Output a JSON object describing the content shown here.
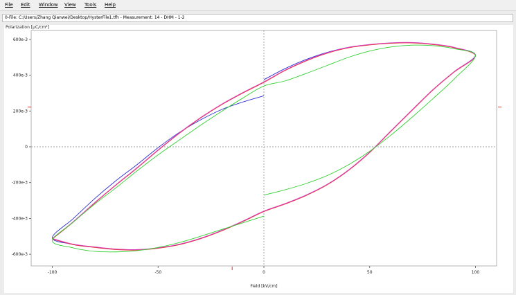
{
  "menu": {
    "file": "File",
    "edit": "Edit",
    "window": "Window",
    "view": "View",
    "tools": "Tools",
    "help": "Help"
  },
  "title_bar": {
    "text": "0-File: C:/Users/Zhang Qianwei/Desktop/HysterFile1.tfh - Measurement: 14 - DHM - 1-2"
  },
  "colors": {
    "blue": "#2b2bd4",
    "red": "#e53030",
    "green": "#2fcf2f",
    "pink": "#e040c0",
    "dashed_axis": "#808080",
    "marker": "#e03030"
  },
  "chart_data": {
    "type": "line",
    "xlabel": "Field [kV/cm]",
    "ylabel": "Polarization [µC/cm²]",
    "xlim": [
      -110,
      110
    ],
    "ylim": [
      -660,
      660
    ],
    "xticks": [
      -100,
      -50,
      0,
      50,
      100
    ],
    "xtick_labels": [
      "-100",
      "-50",
      "0",
      "50",
      "100"
    ],
    "yticks": [
      600,
      400,
      200,
      0,
      -200,
      -400,
      -600
    ],
    "ytick_labels": [
      "600e-3",
      "400e-3",
      "200e-3",
      "0",
      "-200e-3",
      "-400e-3",
      "-600e-3"
    ],
    "grid": false,
    "zero_lines_dashed": true,
    "series": [
      {
        "color_key": "blue",
        "x": [
          0,
          10,
          20,
          30,
          40,
          50,
          60,
          70,
          80,
          90,
          100,
          90,
          80,
          70,
          60,
          50,
          40,
          30,
          20,
          10,
          0,
          -10,
          -20,
          -30,
          -40,
          -50,
          -60,
          -70,
          -80,
          -90,
          -100,
          -90,
          -80,
          -70,
          -60,
          -50,
          -40,
          -30,
          -20,
          -10,
          0
        ],
        "y": [
          375,
          437,
          488,
          528,
          556,
          571,
          580,
          582,
          573,
          555,
          512,
          420,
          320,
          205,
          88,
          -30,
          -130,
          -210,
          -270,
          -318,
          -360,
          -416,
          -468,
          -512,
          -545,
          -565,
          -575,
          -572,
          -560,
          -545,
          -508,
          -400,
          -290,
          -190,
          -100,
          -5,
          80,
          150,
          208,
          250,
          285
        ]
      },
      {
        "color_key": "red",
        "x": [
          -100,
          -90,
          -80,
          -70,
          -60,
          -50,
          -40,
          -30,
          -20,
          -10,
          0,
          10,
          20,
          30,
          40,
          50,
          60,
          70,
          80,
          90,
          100,
          90,
          80,
          70,
          60,
          50,
          40,
          30,
          20,
          10,
          0,
          -10,
          -20,
          -30,
          -40,
          -50,
          -60,
          -70,
          -80,
          -90,
          -100
        ],
        "y": [
          -515,
          -420,
          -315,
          -215,
          -120,
          -20,
          75,
          160,
          235,
          300,
          360,
          426,
          480,
          523,
          553,
          569,
          578,
          580,
          571,
          553,
          508,
          418,
          318,
          203,
          86,
          -32,
          -132,
          -212,
          -272,
          -320,
          -362,
          -418,
          -470,
          -514,
          -547,
          -567,
          -577,
          -574,
          -562,
          -547,
          -515
        ]
      },
      {
        "color_key": "pink",
        "x": [
          -100,
          -90,
          -80,
          -70,
          -60,
          -50,
          -40,
          -30,
          -20,
          -10,
          0,
          10,
          20,
          30,
          40,
          50,
          60,
          70,
          80,
          90,
          100,
          90,
          80,
          70,
          60,
          50,
          40,
          30,
          20,
          10,
          0,
          -10,
          -20,
          -30,
          -40,
          -50,
          -60,
          -70,
          -80,
          -90,
          -100
        ],
        "y": [
          -512,
          -417,
          -312,
          -212,
          -117,
          -17,
          78,
          163,
          238,
          303,
          363,
          429,
          483,
          526,
          556,
          572,
          581,
          583,
          574,
          556,
          510,
          421,
          321,
          206,
          89,
          -29,
          -129,
          -209,
          -269,
          -317,
          -359,
          -415,
          -467,
          -511,
          -544,
          -564,
          -574,
          -571,
          -559,
          -544,
          -512
        ]
      },
      {
        "color_key": "green",
        "x": [
          0,
          10,
          20,
          30,
          40,
          50,
          60,
          70,
          80,
          90,
          100,
          90,
          80,
          70,
          60,
          50,
          40,
          30,
          20,
          10,
          0,
          -10,
          -20,
          -30,
          -40,
          -50,
          -60,
          -70,
          -80,
          -90,
          -100,
          -90,
          -80,
          -70,
          -60,
          -50,
          -40,
          -30,
          -20,
          -10,
          0
        ],
        "y": [
          -270,
          -240,
          -205,
          -160,
          -100,
          -25,
          65,
          165,
          270,
          380,
          510,
          548,
          565,
          568,
          558,
          535,
          500,
          455,
          410,
          368,
          340,
          272,
          198,
          120,
          38,
          -45,
          -135,
          -230,
          -320,
          -420,
          -525,
          -565,
          -584,
          -587,
          -580,
          -562,
          -535,
          -500,
          -462,
          -425,
          -387
        ]
      }
    ],
    "markers": [
      {
        "axis": "y-left",
        "value": 222
      },
      {
        "axis": "y-right",
        "value": 222
      },
      {
        "axis": "x-bottom",
        "value": -15
      }
    ]
  }
}
